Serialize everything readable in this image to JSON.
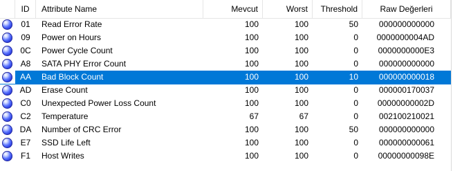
{
  "columns": {
    "id": "ID",
    "name": "Attribute Name",
    "current": "Mevcut",
    "worst": "Worst",
    "threshold": "Threshold",
    "raw": "Raw Değerleri"
  },
  "status_color": "#2a3ff0",
  "selected_color": "#0078d7",
  "selected_row_index": 4,
  "rows": [
    {
      "id": "01",
      "name": "Read Error Rate",
      "current": "100",
      "worst": "100",
      "threshold": "50",
      "raw": "000000000000",
      "status_icon": "blue-ok-icon"
    },
    {
      "id": "09",
      "name": "Power on Hours",
      "current": "100",
      "worst": "100",
      "threshold": "0",
      "raw": "0000000004AD",
      "status_icon": "blue-ok-icon"
    },
    {
      "id": "0C",
      "name": "Power Cycle Count",
      "current": "100",
      "worst": "100",
      "threshold": "0",
      "raw": "0000000000E3",
      "status_icon": "blue-ok-icon"
    },
    {
      "id": "A8",
      "name": "SATA PHY Error Count",
      "current": "100",
      "worst": "100",
      "threshold": "0",
      "raw": "000000000000",
      "status_icon": "blue-ok-icon"
    },
    {
      "id": "AA",
      "name": "Bad Block Count",
      "current": "100",
      "worst": "100",
      "threshold": "10",
      "raw": "000000000018",
      "status_icon": "blue-ok-icon"
    },
    {
      "id": "AD",
      "name": "Erase Count",
      "current": "100",
      "worst": "100",
      "threshold": "0",
      "raw": "000000170037",
      "status_icon": "blue-ok-icon"
    },
    {
      "id": "C0",
      "name": "Unexpected Power Loss Count",
      "current": "100",
      "worst": "100",
      "threshold": "0",
      "raw": "00000000002D",
      "status_icon": "blue-ok-icon"
    },
    {
      "id": "C2",
      "name": "Temperature",
      "current": "67",
      "worst": "67",
      "threshold": "0",
      "raw": "002100210021",
      "status_icon": "blue-ok-icon"
    },
    {
      "id": "DA",
      "name": "Number of CRC Error",
      "current": "100",
      "worst": "100",
      "threshold": "50",
      "raw": "000000000000",
      "status_icon": "blue-ok-icon"
    },
    {
      "id": "E7",
      "name": "SSD Life Left",
      "current": "100",
      "worst": "100",
      "threshold": "0",
      "raw": "000000000061",
      "status_icon": "blue-ok-icon"
    },
    {
      "id": "F1",
      "name": "Host Writes",
      "current": "100",
      "worst": "100",
      "threshold": "0",
      "raw": "00000000098E",
      "status_icon": "blue-ok-icon"
    }
  ]
}
